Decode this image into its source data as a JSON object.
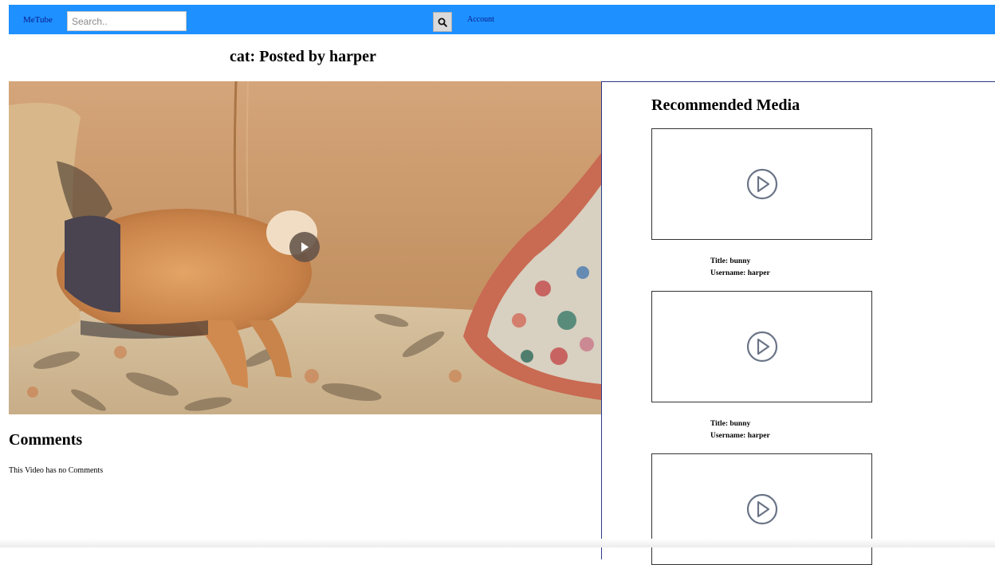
{
  "navbar": {
    "brand": "MeTube",
    "search_placeholder": "Search..",
    "search_icon": "search-icon",
    "account_label": "Account",
    "color": "#1e90ff"
  },
  "video": {
    "title": "cat: Posted by harper",
    "play_icon": "play-icon"
  },
  "comments": {
    "heading": "Comments",
    "empty_text": "This Video has no Comments"
  },
  "recommended": {
    "heading": "Recommended Media",
    "items": [
      {
        "title_line": "Title: bunny",
        "username_line": "Username: harper",
        "icon": "play-circle-icon"
      },
      {
        "title_line": "Title: bunny",
        "username_line": "Username: harper",
        "icon": "play-circle-icon"
      },
      {
        "icon": "play-circle-icon"
      }
    ]
  }
}
